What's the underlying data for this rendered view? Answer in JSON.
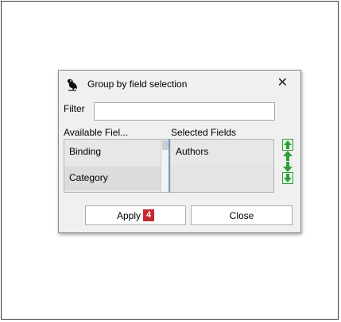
{
  "dialog": {
    "title": "Group by field selection",
    "close_label": "✕",
    "filter_label": "Filter",
    "filter_value": "",
    "available_label": "Available Fiel...",
    "selected_label": "Selected Fields",
    "available_items": [
      "Binding",
      "Category"
    ],
    "selected_items": [
      "Authors"
    ],
    "apply_label": "Apply",
    "apply_badge": "4",
    "close_button_label": "Close"
  },
  "colors": {
    "badge": "#c8262e",
    "arrow_green": "#2e9e3a",
    "selection_border": "#6c9bd2"
  },
  "icons": {
    "app": "bird-icon",
    "move_up": "arrow-up-icon",
    "move_down": "arrow-down-icon"
  }
}
